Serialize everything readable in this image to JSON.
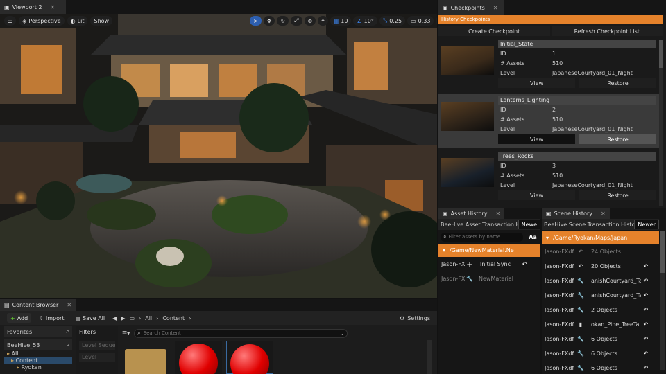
{
  "viewport": {
    "tab": "Viewport 2",
    "perspective": "Perspective",
    "lit": "Lit",
    "show": "Show",
    "grid": "10",
    "angle": "10°",
    "scale": "0.25",
    "cam": "0.33"
  },
  "checkpoints": {
    "tab": "Checkpoints",
    "header": "History Checkpoints",
    "create": "Create Checkpoint",
    "refresh": "Refresh Checkpoint List",
    "labels": {
      "id": "ID",
      "assets": "# Assets",
      "level": "Level"
    },
    "view": "View",
    "restore": "Restore",
    "items": [
      {
        "name": "Initial_State",
        "id": "1",
        "assets": "510",
        "level": "JapaneseCourtyard_01_Night"
      },
      {
        "name": "Lanterns_Lighting",
        "id": "2",
        "assets": "510",
        "level": "JapaneseCourtyard_01_Night"
      },
      {
        "name": "Trees_Rocks",
        "id": "3",
        "assets": "510",
        "level": "JapaneseCourtyard_01_Night"
      }
    ]
  },
  "asset_history": {
    "tab": "Asset History",
    "title": "BeeHive Asset Transaction H",
    "newest": "Newe",
    "filter_placeholder": "Filter assets by name",
    "case": "Aa",
    "path": "/Game/NewMaterial.Ne",
    "rows": [
      {
        "user": "Jason-FXd",
        "action": "Initial Sync"
      },
      {
        "user": "Jason-FXd",
        "action": "NewMaterial"
      }
    ]
  },
  "scene_history": {
    "tab": "Scene History",
    "title": "BeeHive Scene Transaction Histo",
    "newest": "Newer",
    "path": "/Game/Ryokan/Maps/Japan",
    "rows": [
      {
        "user": "Jason-FXdf",
        "text": "24 Objects"
      },
      {
        "user": "Jason-FXdf",
        "text": "20 Objects"
      },
      {
        "user": "Jason-FXdf",
        "text": "anishCourtyard_Ta"
      },
      {
        "user": "Jason-FXdf",
        "text": "anishCourtyard_Ta"
      },
      {
        "user": "Jason-FXdf",
        "text": "2 Objects"
      },
      {
        "user": "Jason-FXdf",
        "text": "okan_Pine_TreeTal"
      },
      {
        "user": "Jason-FXdf",
        "text": "6 Objects"
      },
      {
        "user": "Jason-FXdf",
        "text": "6 Objects"
      },
      {
        "user": "Jason-FXdf",
        "text": "6 Objects"
      }
    ]
  },
  "content": {
    "tab": "Content Browser",
    "add": "Add",
    "import": "Import",
    "save_all": "Save All",
    "all": "All",
    "content": "Content",
    "settings": "Settings",
    "favorites": "Favorites",
    "project": "BeeHive_53",
    "filters": "Filters",
    "search_placeholder": "Search Content",
    "tree": [
      "All",
      "Content",
      "Ryokan"
    ],
    "filter_items": [
      "Level Sequen",
      "Level"
    ]
  }
}
